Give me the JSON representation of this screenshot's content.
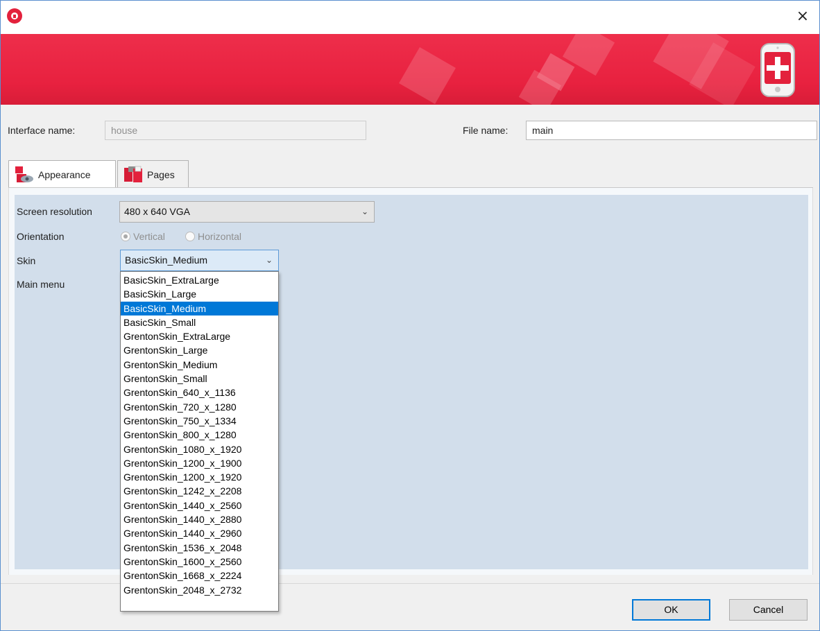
{
  "window": {
    "close_glyph": "×",
    "icon": "grenton-house-icon"
  },
  "banner": {
    "colors": {
      "primary": "#e8213f",
      "accent": "#f8a0ad"
    },
    "logo_icon": "phone-plus-icon"
  },
  "form": {
    "interface_name_label": "Interface name:",
    "interface_name_value": "house",
    "file_name_label": "File name:",
    "file_name_value": "main"
  },
  "tabs": [
    {
      "label": "Appearance",
      "icon": "appearance-icon",
      "active": true
    },
    {
      "label": "Pages",
      "icon": "pages-icon",
      "active": false
    }
  ],
  "appearance": {
    "screen_resolution_label": "Screen resolution",
    "screen_resolution_value": "480 x 640 VGA",
    "orientation_label": "Orientation",
    "orientation_options": [
      "Vertical",
      "Horizontal"
    ],
    "orientation_selected": "Vertical",
    "skin_label": "Skin",
    "skin_value": "BasicSkin_Medium",
    "main_menu_label": "Main menu"
  },
  "skin_options": [
    "BasicSkin_ExtraLarge",
    "BasicSkin_Large",
    "BasicSkin_Medium",
    "BasicSkin_Small",
    "GrentonSkin_ExtraLarge",
    "GrentonSkin_Large",
    "GrentonSkin_Medium",
    "GrentonSkin_Small",
    "GrentonSkin_640_x_1136",
    "GrentonSkin_720_x_1280",
    "GrentonSkin_750_x_1334",
    "GrentonSkin_800_x_1280",
    "GrentonSkin_1080_x_1920",
    "GrentonSkin_1200_x_1900",
    "GrentonSkin_1200_x_1920",
    "GrentonSkin_1242_x_2208",
    "GrentonSkin_1440_x_2560",
    "GrentonSkin_1440_x_2880",
    "GrentonSkin_1440_x_2960",
    "GrentonSkin_1536_x_2048",
    "GrentonSkin_1600_x_2560",
    "GrentonSkin_1668_x_2224",
    "GrentonSkin_2048_x_2732"
  ],
  "skin_selected_index": 2,
  "buttons": {
    "ok_label": "OK",
    "cancel_label": "Cancel"
  }
}
